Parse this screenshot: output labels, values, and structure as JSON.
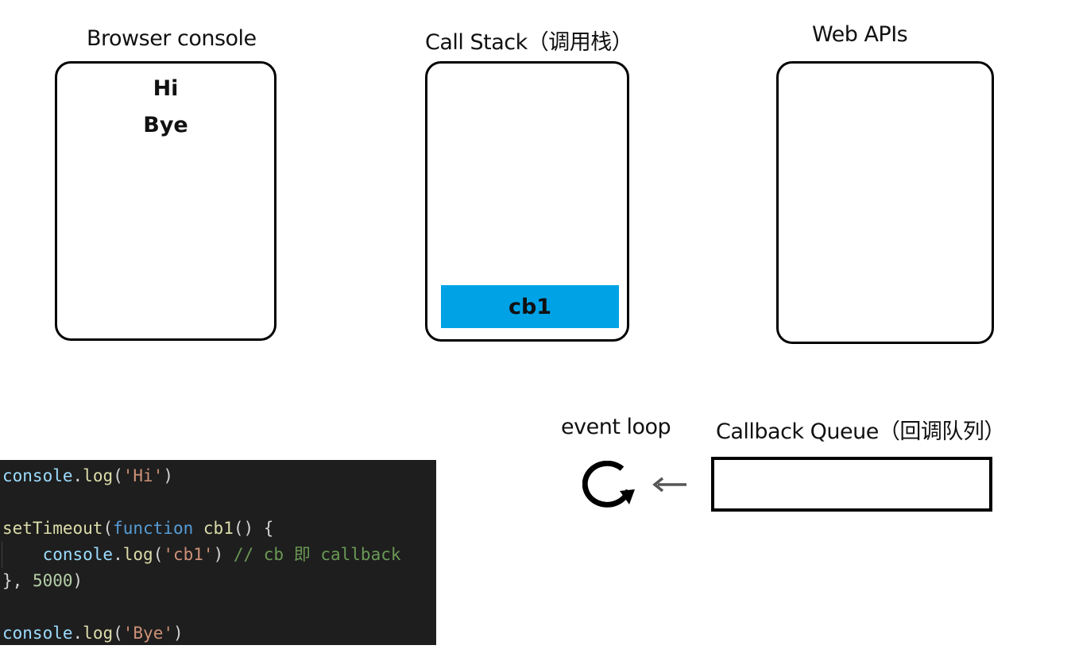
{
  "panels": {
    "browser_console": {
      "title": "Browser console",
      "lines": [
        "Hi",
        "Bye"
      ]
    },
    "call_stack": {
      "title": "Call Stack（调用栈）",
      "frames": [
        "cb1"
      ]
    },
    "web_apis": {
      "title": "Web APIs"
    },
    "callback_queue": {
      "title": "Callback Queue（回调队列）"
    }
  },
  "event_loop": {
    "label": "event loop",
    "icon": "circular-arrow-icon",
    "arrow_icon": "arrow-left-icon"
  },
  "code": {
    "lines": [
      [
        {
          "t": "console",
          "c": "obj"
        },
        {
          "t": ".",
          "c": "pn"
        },
        {
          "t": "log",
          "c": "fn"
        },
        {
          "t": "(",
          "c": "pn"
        },
        {
          "t": "'Hi'",
          "c": "str"
        },
        {
          "t": ")",
          "c": "pn"
        }
      ],
      [],
      [
        {
          "t": "setTimeout",
          "c": "fn"
        },
        {
          "t": "(",
          "c": "pn"
        },
        {
          "t": "function",
          "c": "kw"
        },
        {
          "t": " ",
          "c": "pn"
        },
        {
          "t": "cb1",
          "c": "fn"
        },
        {
          "t": "() {",
          "c": "pn"
        }
      ],
      [
        {
          "t": "    ",
          "c": "pn"
        },
        {
          "t": "console",
          "c": "obj"
        },
        {
          "t": ".",
          "c": "pn"
        },
        {
          "t": "log",
          "c": "fn"
        },
        {
          "t": "(",
          "c": "pn"
        },
        {
          "t": "'cb1'",
          "c": "str"
        },
        {
          "t": ") ",
          "c": "pn"
        },
        {
          "t": "// cb 即 callback",
          "c": "cm"
        }
      ],
      [
        {
          "t": "}, ",
          "c": "pn"
        },
        {
          "t": "5000",
          "c": "num"
        },
        {
          "t": ")",
          "c": "pn"
        }
      ],
      [],
      [
        {
          "t": "console",
          "c": "obj"
        },
        {
          "t": ".",
          "c": "pn"
        },
        {
          "t": "log",
          "c": "fn"
        },
        {
          "t": "(",
          "c": "pn"
        },
        {
          "t": "'Bye'",
          "c": "str"
        },
        {
          "t": ")",
          "c": "pn"
        }
      ]
    ]
  },
  "colors": {
    "stack_frame": "#00a2e6",
    "code_background": "#1e1e1e",
    "border": "#000000",
    "arrow": "#555555"
  }
}
